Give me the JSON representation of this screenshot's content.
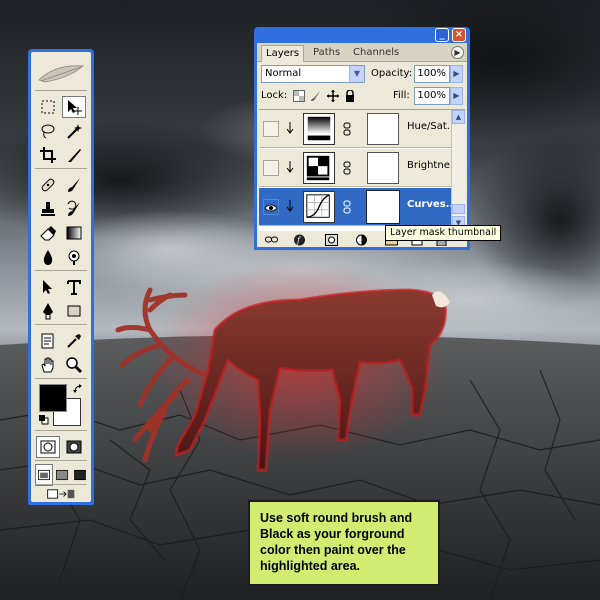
{
  "layers_panel": {
    "tabs": [
      {
        "label": "Layers",
        "active": true
      },
      {
        "label": "Paths",
        "active": false
      },
      {
        "label": "Channels",
        "active": false
      }
    ],
    "window_buttons": {
      "minimize": "_",
      "close": "×"
    },
    "blend_mode": "Normal",
    "opacity_label": "Opacity:",
    "opacity_value": "100%",
    "lock_label": "Lock:",
    "fill_label": "Fill:",
    "fill_value": "100%",
    "layers": [
      {
        "name": "Hue/Sat...",
        "visible": false,
        "selected": false,
        "thumb_icon": "hue-saturation-icon"
      },
      {
        "name": "Brightne...",
        "visible": false,
        "selected": false,
        "thumb_icon": "brightness-contrast-icon"
      },
      {
        "name": "Curves...",
        "visible": true,
        "selected": true,
        "thumb_icon": "curves-icon"
      }
    ]
  },
  "tooltip": {
    "text": "Layer mask thumbnail"
  },
  "instruction_note": {
    "lines": [
      "Use soft round brush and",
      "Black as your forground",
      "color then paint over the",
      "highlighted area."
    ]
  },
  "tools_palette": {
    "foreground_color": "#000000",
    "background_color": "#ffffff",
    "tools": [
      "rectangular-marquee-icon",
      "move-icon",
      "lasso-icon",
      "magic-wand-icon",
      "crop-icon",
      "slice-icon",
      "healing-brush-icon",
      "brush-icon",
      "clone-stamp-icon",
      "history-brush-icon",
      "eraser-icon",
      "gradient-icon",
      "blur-icon",
      "dodge-icon",
      "path-selection-icon",
      "type-icon",
      "pen-icon",
      "rectangle-shape-icon",
      "notes-icon",
      "eyedropper-icon",
      "hand-icon",
      "zoom-icon"
    ]
  },
  "colors": {
    "xp_blue": "#2f6fe0",
    "panel_bg": "#ece9d8",
    "selection_blue": "#316ac5",
    "note_bg": "#d2ec72",
    "deer_highlight": "#d61f1f"
  }
}
